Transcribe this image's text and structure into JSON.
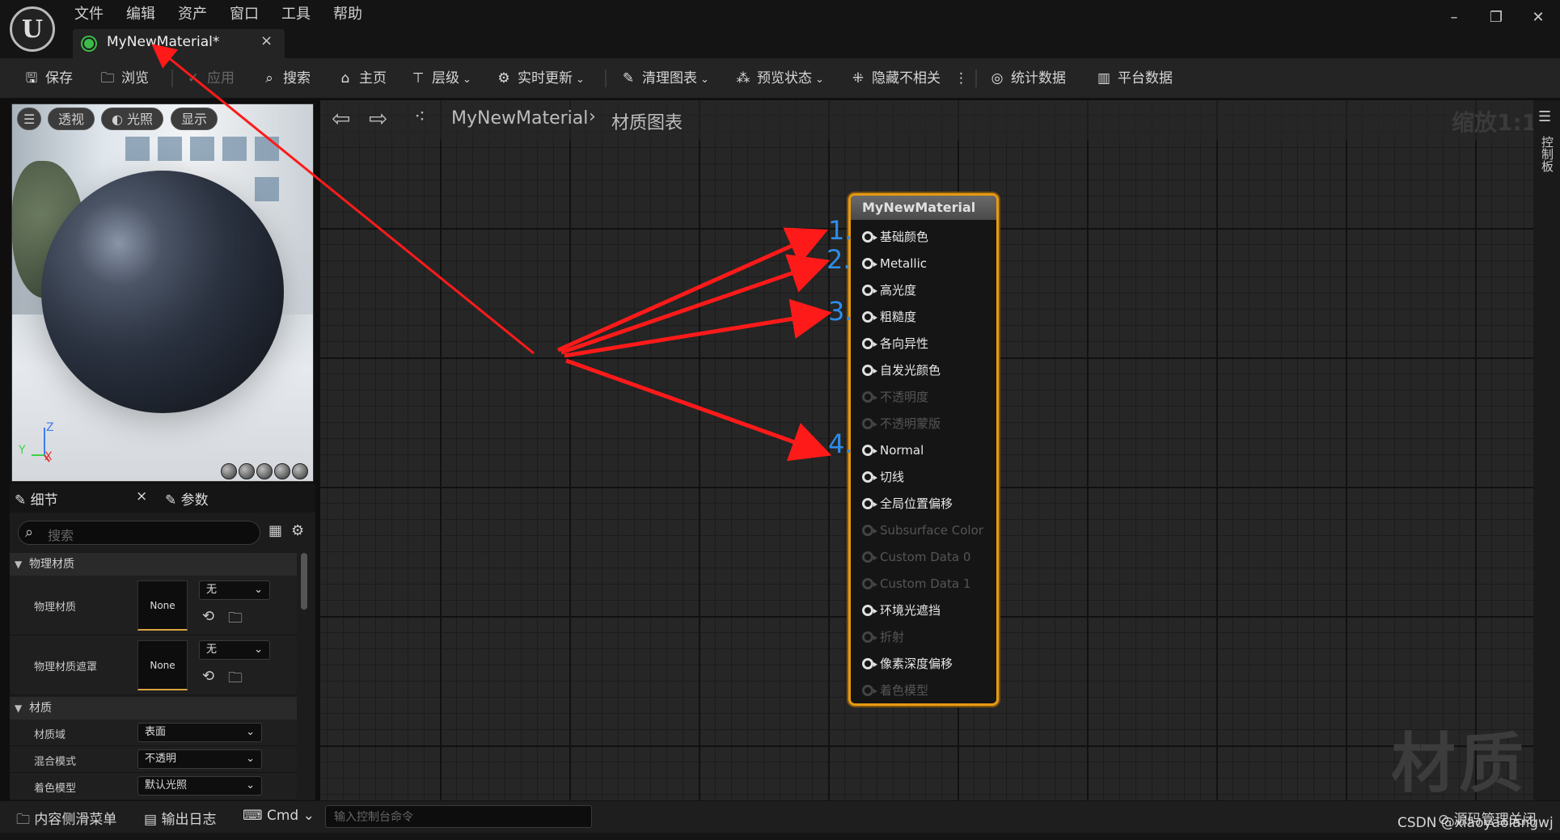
{
  "app": {
    "logo_text": "U",
    "menu": [
      "文件",
      "编辑",
      "资产",
      "窗口",
      "工具",
      "帮助"
    ],
    "tab_title": "MyNewMaterial*",
    "tab_close": "×",
    "window_buttons": [
      "–",
      "❐",
      "✕"
    ]
  },
  "toolbar": {
    "save": "保存",
    "browse": "浏览",
    "apply": "应用",
    "search": "搜索",
    "home": "主页",
    "hierarchy": "层级",
    "live_update": "实时更新",
    "clean_graph": "清理图表",
    "preview_state": "预览状态",
    "hide_unrelated": "隐藏不相关",
    "more": "⋮",
    "stats": "统计数据",
    "platform_stats": "平台数据"
  },
  "viewport": {
    "menu_icon": "☰",
    "perspective": "透视",
    "lit": "光照",
    "show": "显示",
    "axis_z": "Z",
    "axis_y": "Y",
    "axis_x": "X"
  },
  "details": {
    "tab_details": "细节",
    "tab_close": "×",
    "tab_params": "参数",
    "search_placeholder": "搜索",
    "cat_physical": "物理材质",
    "phys_mat_label": "物理材质",
    "phys_mat_thumb": "None",
    "phys_mat_value": "无",
    "phys_mask_label": "物理材质遮罩",
    "phys_mask_thumb": "None",
    "phys_mask_value": "无",
    "cat_material": "材质",
    "domain_label": "材质域",
    "domain_value": "表面",
    "blend_label": "混合模式",
    "blend_value": "不透明",
    "shading_label": "着色模型",
    "shading_value": "默认光照"
  },
  "graph": {
    "breadcrumb_root": "MyNewMaterial",
    "breadcrumb_sep": "›",
    "breadcrumb_leaf": "材质图表",
    "zoom": "缩放1:1",
    "watermark": "材质",
    "side_panel": "控制板"
  },
  "node": {
    "title": "MyNewMaterial",
    "pins": [
      {
        "label": "基础颜色",
        "enabled": true
      },
      {
        "label": "Metallic",
        "enabled": true
      },
      {
        "label": "高光度",
        "enabled": true
      },
      {
        "label": "粗糙度",
        "enabled": true
      },
      {
        "label": "各向异性",
        "enabled": true
      },
      {
        "label": "自发光颜色",
        "enabled": true
      },
      {
        "label": "不透明度",
        "enabled": false
      },
      {
        "label": "不透明蒙版",
        "enabled": false
      },
      {
        "label": "Normal",
        "enabled": true
      },
      {
        "label": "切线",
        "enabled": true
      },
      {
        "label": "全局位置偏移",
        "enabled": true
      },
      {
        "label": "Subsurface Color",
        "enabled": false
      },
      {
        "label": "Custom Data 0",
        "enabled": false
      },
      {
        "label": "Custom Data 1",
        "enabled": false
      },
      {
        "label": "环境光遮挡",
        "enabled": true
      },
      {
        "label": "折射",
        "enabled": false
      },
      {
        "label": "像素深度偏移",
        "enabled": true
      },
      {
        "label": "着色模型",
        "enabled": false
      }
    ]
  },
  "annotations": {
    "labels": [
      "1.",
      "2.",
      "3.",
      "4."
    ],
    "arrow_color": "#ff1a1a",
    "number_color": "#2e8de8"
  },
  "bottombar": {
    "content_drawer": "内容侧滑菜单",
    "output_log": "输出日志",
    "cmd": "Cmd",
    "cmd_placeholder": "输入控制台命令",
    "source_control": "源码管理关闭"
  },
  "watermark_csdn": "CSDN @xiaoyaolangwj",
  "colors": {
    "accent_orange": "#e89a12",
    "green_tab_icon": "#3dbb4a",
    "background": "#0f0f0f"
  }
}
